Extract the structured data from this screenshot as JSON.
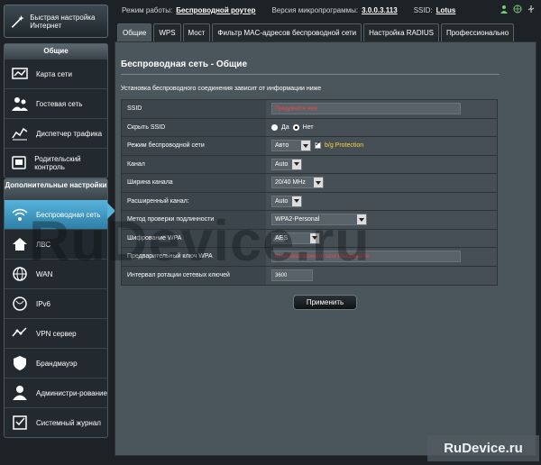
{
  "header": {
    "mode_label": "Режим работы:",
    "mode_value": "Беспроводной роутер",
    "firmware_label": "Версия микропрограммы:",
    "firmware_value": "3.0.0.3.113",
    "ssid_label": "SSID:",
    "ssid_value": "Lotus"
  },
  "qis": {
    "label": "Быстрая настройка Интернет"
  },
  "sidebar": {
    "general_title": "Общие",
    "general_items": [
      {
        "label": "Карта сети",
        "icon": "network-map-icon"
      },
      {
        "label": "Гостевая сеть",
        "icon": "guest-network-icon"
      },
      {
        "label": "Диспетчер трафика",
        "icon": "traffic-manager-icon"
      },
      {
        "label": "Родительский контроль",
        "icon": "parental-control-icon"
      }
    ],
    "advanced_title": "Дополнительные настройки",
    "advanced_items": [
      {
        "label": "Беспроводная сеть",
        "icon": "wireless-icon",
        "active": true
      },
      {
        "label": "ЛВС",
        "icon": "lan-icon"
      },
      {
        "label": "WAN",
        "icon": "wan-icon"
      },
      {
        "label": "IPv6",
        "icon": "ipv6-icon"
      },
      {
        "label": "VPN сервер",
        "icon": "vpn-icon"
      },
      {
        "label": "Брандмауэр",
        "icon": "firewall-icon"
      },
      {
        "label": "Администри-рование",
        "icon": "admin-icon"
      },
      {
        "label": "Системный журнал",
        "icon": "syslog-icon"
      }
    ]
  },
  "tabs": [
    "Общие",
    "WPS",
    "Мост",
    "Фильтр MAC-адресов беспроводной сети",
    "Настройка RADIUS",
    "Профессионально"
  ],
  "page": {
    "title": "Беспроводная сеть - Общие",
    "description": "Установка беспроводного соединения зависит от информации ниже"
  },
  "form": {
    "ssid_label": "SSID",
    "ssid_value": "Придумайте имя",
    "hide_ssid_label": "Скрыть SSID",
    "hide_yes": "Да",
    "hide_no": "Нет",
    "mode_label": "Режим беспроводной сети",
    "mode_value": "Авто",
    "bg_protection": "b/g Protection",
    "channel_label": "Канал",
    "channel_value": "Auto",
    "bandwidth_label": "Ширина канала",
    "bandwidth_value": "20/40 MHz",
    "ext_channel_label": "Расширенный канал:",
    "ext_channel_value": "Auto",
    "auth_label": "Метод проверки подлинности",
    "auth_value": "WPA2-Personal",
    "enc_label": "Шифрование WPA",
    "enc_value": "AES",
    "psk_label": "Предварительный ключ WPA",
    "psk_value": "Ключ безопасности сети Придумайте",
    "rotation_label": "Интервал ротации сетевых ключей",
    "rotation_value": "3600"
  },
  "apply_label": "Применить",
  "watermark": "RuDevice.ru",
  "watermark2": "RuDevice.ru"
}
